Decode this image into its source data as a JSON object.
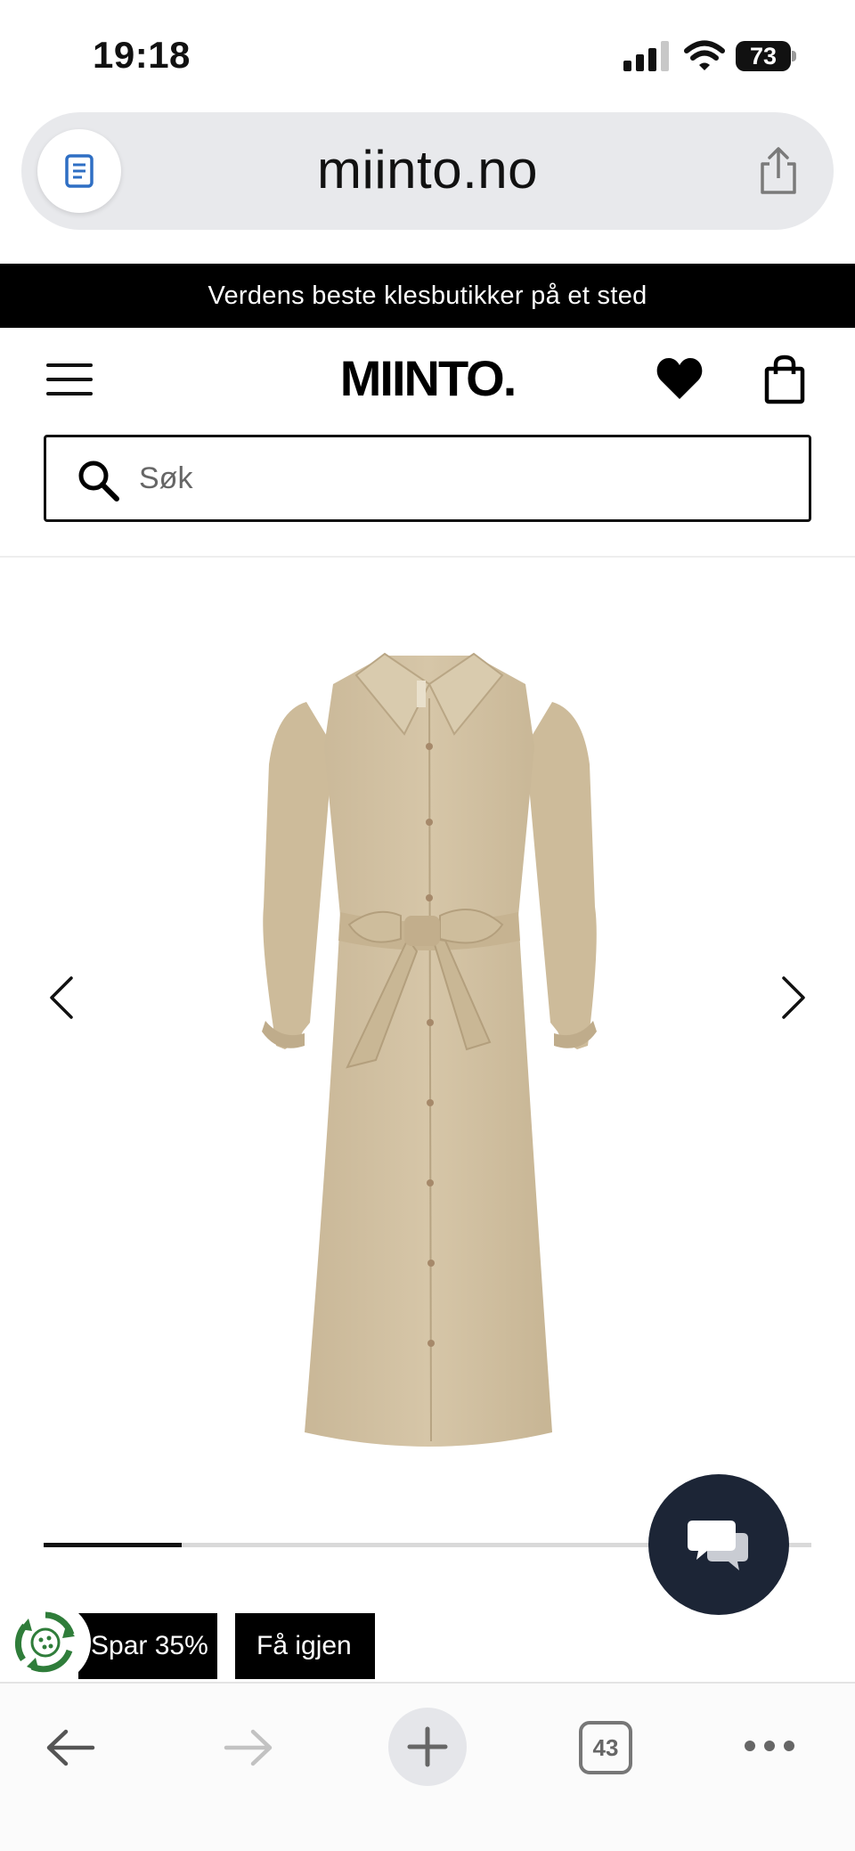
{
  "status_bar": {
    "time": "19:18",
    "battery": "73"
  },
  "browser": {
    "url": "miinto.no",
    "open_tabs": "43"
  },
  "promo": {
    "text": "Verdens beste klesbutikker på et sted"
  },
  "header": {
    "logo": "MIINTO."
  },
  "search": {
    "placeholder": "Søk",
    "value": ""
  },
  "gallery": {
    "progress": 0.18
  },
  "tags": [
    {
      "label": "Spar 35%"
    },
    {
      "label": "Få igjen"
    }
  ],
  "icons": {
    "reader": "reader-mode-icon",
    "share": "share-icon",
    "menu": "hamburger-menu-icon",
    "wishlist": "heart-icon",
    "cart": "shopping-bag-icon",
    "search": "search-icon",
    "prev": "chevron-left-icon",
    "next": "chevron-right-icon",
    "chat": "chat-bubbles-icon",
    "eco": "recycle-leaf-icon"
  },
  "colors": {
    "promo_bg": "#000000",
    "chat_bg": "#1c2536",
    "dress": "#d2c2a4",
    "reader_icon": "#2f6fc4"
  }
}
